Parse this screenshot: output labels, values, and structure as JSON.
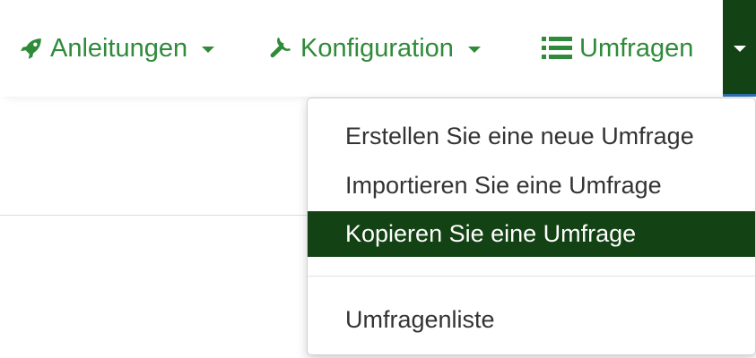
{
  "navbar": {
    "anleitungen": {
      "label": "Anleitungen",
      "icon": "rocket-icon"
    },
    "konfiguration": {
      "label": "Konfiguration",
      "icon": "wrench-icon"
    },
    "umfragen": {
      "label": "Umfragen",
      "icon": "list-icon"
    },
    "toggle_icon": "caret-down-icon"
  },
  "dropdown": {
    "items": [
      {
        "label": "Erstellen Sie eine neue Umfrage",
        "active": false
      },
      {
        "label": "Importieren Sie eine Umfrage",
        "active": false
      },
      {
        "label": "Kopieren Sie eine Umfrage",
        "active": true
      },
      {
        "label": "Umfragenliste",
        "active": false
      }
    ]
  },
  "colors": {
    "accent_green": "#2f8a3a",
    "dark_green": "#134214",
    "text": "#333333"
  }
}
